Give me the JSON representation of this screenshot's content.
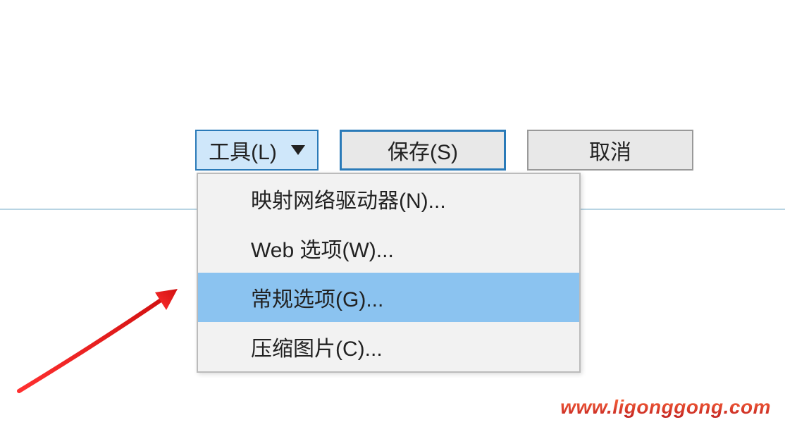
{
  "toolbar": {
    "tools_label": "工具(L)",
    "save_label": "保存(S)",
    "cancel_label": "取消"
  },
  "dropdown": {
    "items": [
      {
        "label": "映射网络驱动器(N)...",
        "highlighted": false
      },
      {
        "label": "Web 选项(W)...",
        "highlighted": false
      },
      {
        "label": "常规选项(G)...",
        "highlighted": true
      },
      {
        "label": "压缩图片(C)...",
        "highlighted": false
      }
    ]
  },
  "watermark": {
    "text": "www.ligonggong.com"
  }
}
